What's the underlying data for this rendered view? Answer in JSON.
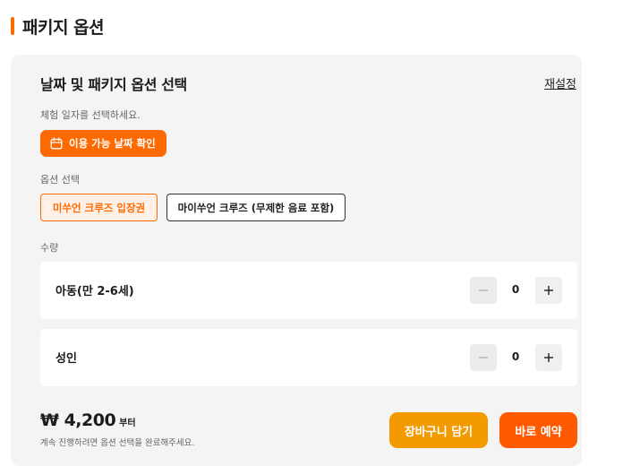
{
  "section": {
    "title": "패키지 옵션"
  },
  "card": {
    "title": "날짜 및 패키지 옵션 선택",
    "reset_label": "재설정",
    "date_hint": "체험 일자를 선택하세요.",
    "date_button_label": "이용 가능 날짜 확인",
    "date_button_icon": "calendar-icon",
    "options_label": "옵션 선택",
    "options": [
      {
        "label": "미쑤언 크루즈 입장권",
        "selected": true
      },
      {
        "label": "마이쑤언 크루즈 (무제한 음료 포함)",
        "selected": false
      }
    ],
    "quantity_label": "수량",
    "quantities": [
      {
        "name": "아동(만 2-6세)",
        "value": "0"
      },
      {
        "name": "성인",
        "value": "0"
      }
    ]
  },
  "footer": {
    "price": "₩ 4,200",
    "price_suffix": "부터",
    "note": "계속 진행하려면 옵션 선택을 완료해주세요.",
    "cart_label": "장바구니 담기",
    "book_label": "바로 예약"
  },
  "colors": {
    "accent": "#ff6a00",
    "cart_button": "#f29a00",
    "book_button": "#ff5a00",
    "card_background": "#f4f4f4"
  }
}
